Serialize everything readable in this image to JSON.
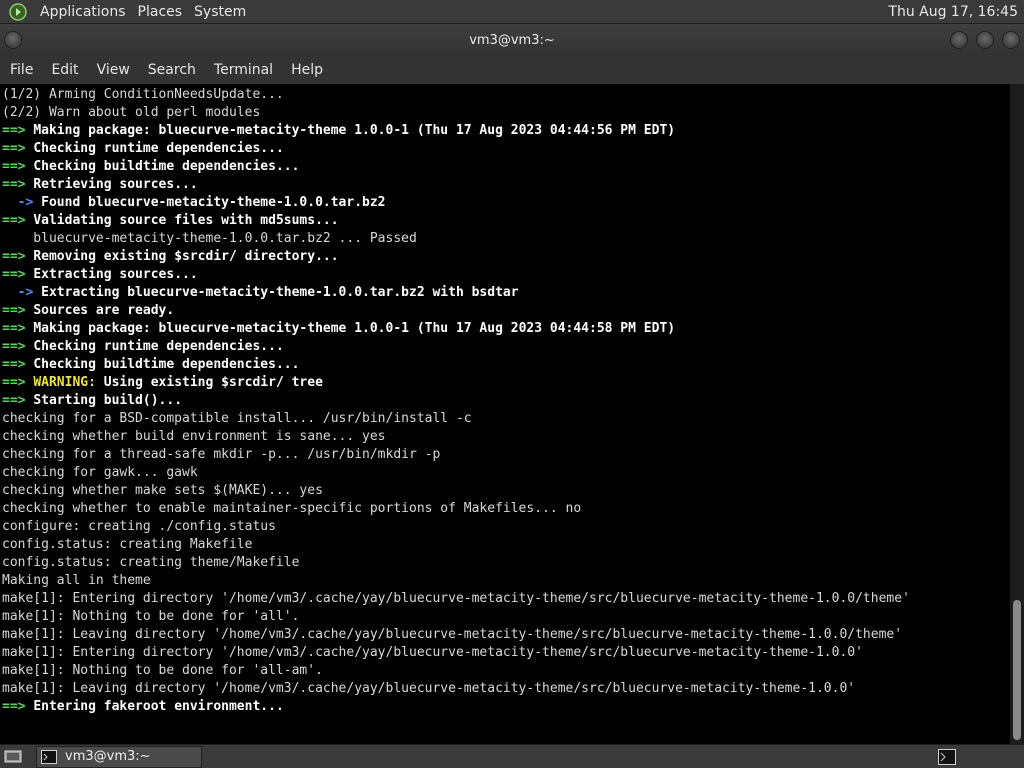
{
  "top_panel": {
    "menus": [
      "Applications",
      "Places",
      "System"
    ],
    "clock": "Thu Aug 17, 16:45"
  },
  "window": {
    "title": "vm3@vm3:~"
  },
  "menubar": {
    "items": [
      "File",
      "Edit",
      "View",
      "Search",
      "Terminal",
      "Help"
    ]
  },
  "terminal": {
    "lines": [
      {
        "kind": "plain",
        "text": "(1/2) Arming ConditionNeedsUpdate..."
      },
      {
        "kind": "plain",
        "text": "(2/2) Warn about old perl modules"
      },
      {
        "kind": "arrow",
        "text": "Making package: bluecurve-metacity-theme 1.0.0-1 (Thu 17 Aug 2023 04:44:56 PM EDT)"
      },
      {
        "kind": "arrow",
        "text": "Checking runtime dependencies..."
      },
      {
        "kind": "arrow",
        "text": "Checking buildtime dependencies..."
      },
      {
        "kind": "arrow",
        "text": "Retrieving sources..."
      },
      {
        "kind": "sub",
        "text": "Found bluecurve-metacity-theme-1.0.0.tar.bz2"
      },
      {
        "kind": "arrow",
        "text": "Validating source files with md5sums..."
      },
      {
        "kind": "plain",
        "text": "    bluecurve-metacity-theme-1.0.0.tar.bz2 ... Passed"
      },
      {
        "kind": "arrow",
        "text": "Removing existing $srcdir/ directory..."
      },
      {
        "kind": "arrow",
        "text": "Extracting sources..."
      },
      {
        "kind": "sub",
        "text": "Extracting bluecurve-metacity-theme-1.0.0.tar.bz2 with bsdtar"
      },
      {
        "kind": "arrow",
        "text": "Sources are ready."
      },
      {
        "kind": "arrow",
        "text": "Making package: bluecurve-metacity-theme 1.0.0-1 (Thu 17 Aug 2023 04:44:58 PM EDT)"
      },
      {
        "kind": "arrow",
        "text": "Checking runtime dependencies..."
      },
      {
        "kind": "arrow",
        "text": "Checking buildtime dependencies..."
      },
      {
        "kind": "warn",
        "label": "WARNING:",
        "text": " Using existing $srcdir/ tree"
      },
      {
        "kind": "arrow",
        "text": "Starting build()..."
      },
      {
        "kind": "plain",
        "text": "checking for a BSD-compatible install... /usr/bin/install -c"
      },
      {
        "kind": "plain",
        "text": "checking whether build environment is sane... yes"
      },
      {
        "kind": "plain",
        "text": "checking for a thread-safe mkdir -p... /usr/bin/mkdir -p"
      },
      {
        "kind": "plain",
        "text": "checking for gawk... gawk"
      },
      {
        "kind": "plain",
        "text": "checking whether make sets $(MAKE)... yes"
      },
      {
        "kind": "plain",
        "text": "checking whether to enable maintainer-specific portions of Makefiles... no"
      },
      {
        "kind": "plain",
        "text": "configure: creating ./config.status"
      },
      {
        "kind": "plain",
        "text": "config.status: creating Makefile"
      },
      {
        "kind": "plain",
        "text": "config.status: creating theme/Makefile"
      },
      {
        "kind": "plain",
        "text": "Making all in theme"
      },
      {
        "kind": "plain",
        "text": "make[1]: Entering directory '/home/vm3/.cache/yay/bluecurve-metacity-theme/src/bluecurve-metacity-theme-1.0.0/theme'"
      },
      {
        "kind": "plain",
        "text": "make[1]: Nothing to be done for 'all'."
      },
      {
        "kind": "plain",
        "text": "make[1]: Leaving directory '/home/vm3/.cache/yay/bluecurve-metacity-theme/src/bluecurve-metacity-theme-1.0.0/theme'"
      },
      {
        "kind": "plain",
        "text": "make[1]: Entering directory '/home/vm3/.cache/yay/bluecurve-metacity-theme/src/bluecurve-metacity-theme-1.0.0'"
      },
      {
        "kind": "plain",
        "text": "make[1]: Nothing to be done for 'all-am'."
      },
      {
        "kind": "plain",
        "text": "make[1]: Leaving directory '/home/vm3/.cache/yay/bluecurve-metacity-theme/src/bluecurve-metacity-theme-1.0.0'"
      },
      {
        "kind": "arrow",
        "text": "Entering fakeroot environment..."
      }
    ],
    "arrow_glyph": "==>",
    "sub_arrow_glyph": "  ->"
  },
  "taskbar": {
    "task_label": "vm3@vm3:~"
  },
  "icons": {
    "panel_logo": "foot-logo-icon",
    "show_desktop": "show-desktop-icon",
    "task": "terminal-icon",
    "tray": "terminal-icon"
  },
  "colors": {
    "arrow": "#4fdc4f",
    "sub_arrow": "#4a8cff",
    "warning": "#f0e04a",
    "terminal_bg": "#000000"
  }
}
